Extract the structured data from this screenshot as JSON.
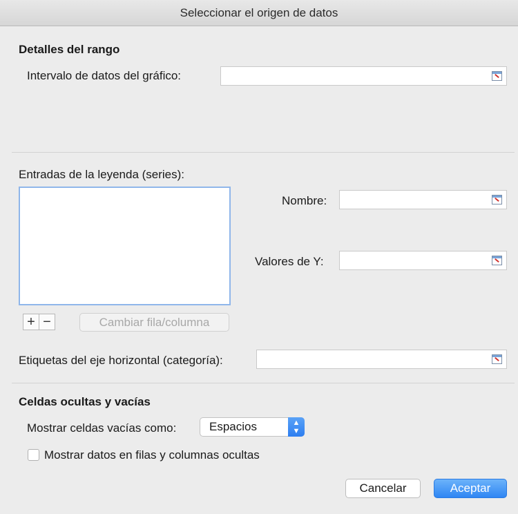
{
  "window": {
    "title": "Seleccionar el origen de datos"
  },
  "range": {
    "heading": "Detalles del rango",
    "data_range_label": "Intervalo de datos del gráfico:",
    "data_range_value": ""
  },
  "series": {
    "heading": "Entradas de la leyenda (series):",
    "items": [],
    "add_label": "+",
    "remove_label": "−",
    "switch_label": "Cambiar fila/columna",
    "name_label": "Nombre:",
    "name_value": "",
    "yvalues_label": "Valores de Y:",
    "yvalues_value": ""
  },
  "axis": {
    "label": "Etiquetas del eje horizontal (categoría):",
    "value": ""
  },
  "hidden": {
    "heading": "Celdas ocultas y vacías",
    "show_empty_label": "Mostrar celdas vacías como:",
    "show_empty_value": "Espacios",
    "show_hidden_label": "Mostrar datos en filas y columnas ocultas",
    "show_hidden_checked": false
  },
  "buttons": {
    "cancel": "Cancelar",
    "ok": "Aceptar"
  },
  "colors": {
    "accent": "#2f86f3",
    "list_border": "#8fb6ea"
  }
}
